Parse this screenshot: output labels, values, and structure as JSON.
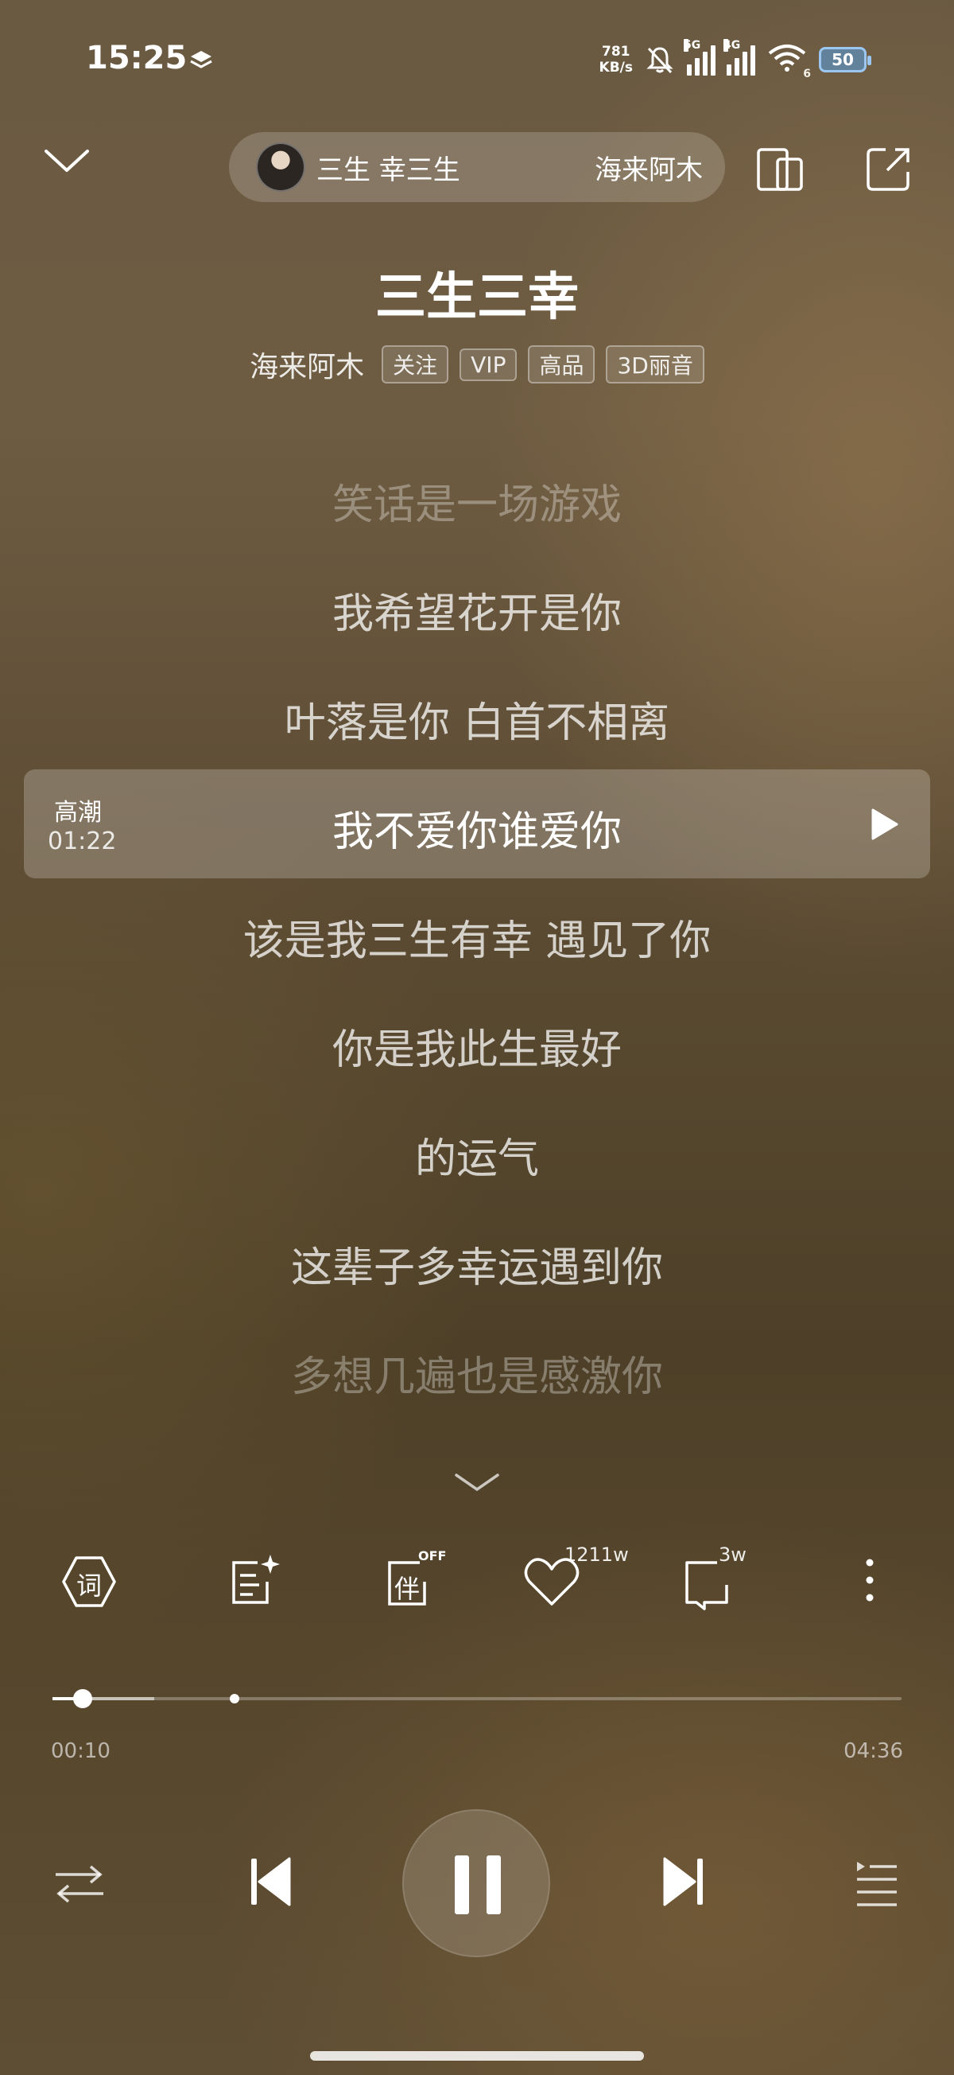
{
  "status_bar": {
    "time": "15:25",
    "net_speed_value": "781",
    "net_speed_unit": "KB/s",
    "sig1_label": "5G",
    "sig2_label": "4G",
    "wifi_label": "6",
    "battery": "50"
  },
  "header": {
    "pill_song": "三生 幸三生",
    "pill_artist": "海来阿木",
    "title": "三生三幸",
    "artist": "海来阿木",
    "tags": [
      "关注",
      "VIP",
      "高品",
      "3D丽音"
    ]
  },
  "lyrics": [
    "笑话是一场游戏",
    "我希望花开是你",
    "叶落是你 白首不相离",
    "我不爱你谁爱你",
    "该是我三生有幸 遇见了你",
    "你是我此生最好",
    "的运气",
    "这辈子多幸运遇到你",
    "多想几遍也是感激你"
  ],
  "highlight": {
    "label": "高潮",
    "time": "01:22"
  },
  "actions": {
    "lyrics_icon_char": "词",
    "accompany_icon_char": "伴",
    "accompany_badge": "OFF",
    "like_count": "1211w",
    "comment_count": "3w"
  },
  "progress": {
    "current": "00:10",
    "total": "04:36",
    "fraction": 0.036
  },
  "colors": {
    "accent": "#ffffff",
    "background": "#5a4a32"
  }
}
